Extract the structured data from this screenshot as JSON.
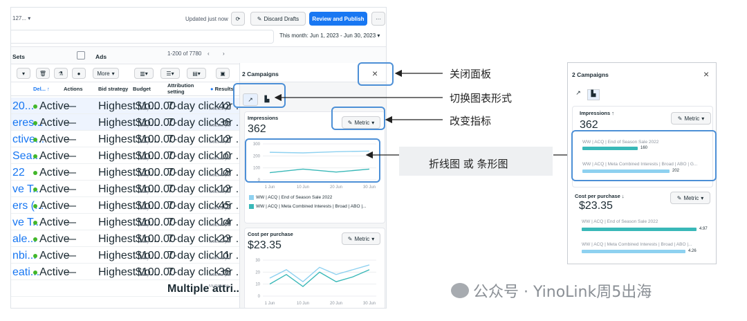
{
  "toolbar": {
    "account": "127...",
    "updated": "Updated just now",
    "discard": "Discard Drafts",
    "publish": "Review and Publish",
    "more": "···",
    "date_range": "This month: Jun 1, 2023 - Jun 30, 2023"
  },
  "tabs": {
    "sets": "Sets",
    "ads": "Ads",
    "pager": "1-200 of 7780"
  },
  "actions": {
    "more": "More"
  },
  "table": {
    "headers": [
      "Del... ↑",
      "Actions",
      "Bid strategy",
      "Budget",
      "Attribution setting",
      "Results"
    ],
    "rows": [
      {
        "name": "20...",
        "status": "Active",
        "actions": "—",
        "bid": "Highest vo...",
        "budget": "$100.00",
        "period": "Daily",
        "attr": "7-day click or ...",
        "result": "42",
        "rsub": "Website pur"
      },
      {
        "name": "eres...",
        "status": "Active",
        "actions": "—",
        "bid": "Highest vo...",
        "budget": "$100.00",
        "period": "Daily",
        "attr": "7-day click or ...",
        "result": "36",
        "rsub": "Website pur"
      },
      {
        "name": "ctive...",
        "status": "Active",
        "actions": "—",
        "bid": "Highest vo...",
        "budget": "$100.00",
        "period": "Daily",
        "attr": "7-day click or ...",
        "result": "12",
        "rsub": "Website pur"
      },
      {
        "name": "Sea...",
        "status": "Active",
        "actions": "—",
        "bid": "Highest vo...",
        "budget": "$100.00",
        "period": "Daily",
        "attr": "7-day click or ...",
        "result": "10",
        "rsub": "Website pur"
      },
      {
        "name": "22",
        "status": "Active",
        "actions": "—",
        "bid": "Highest vo...",
        "budget": "$100.00",
        "period": "Daily",
        "attr": "7-day click or ...",
        "result": "18",
        "rsub": "Website pur"
      },
      {
        "name": "ve T...",
        "status": "Active",
        "actions": "—",
        "bid": "Highest vo...",
        "budget": "$100.00",
        "period": "Daily",
        "attr": "7-day click or ...",
        "result": "12",
        "rsub": "Website pur"
      },
      {
        "name": "ers (...",
        "status": "Active",
        "actions": "—",
        "bid": "Highest vo...",
        "budget": "$100.00",
        "period": "Daily",
        "attr": "7-day click or ...",
        "result": "45",
        "rsub": "Website pur"
      },
      {
        "name": "ve T...",
        "status": "Active",
        "actions": "—",
        "bid": "Highest vo...",
        "budget": "$100.00",
        "period": "Daily",
        "attr": "7-day click or ...",
        "result": "14",
        "rsub": "Website pur"
      },
      {
        "name": "ale...",
        "status": "Active",
        "actions": "—",
        "bid": "Highest vo...",
        "budget": "$100.00",
        "period": "Daily",
        "attr": "7-day click or ...",
        "result": "23",
        "rsub": "Website pur"
      },
      {
        "name": "nbi...",
        "status": "Active",
        "actions": "—",
        "bid": "Highest vo...",
        "budget": "$100.00",
        "period": "Daily",
        "attr": "7-day click or ...",
        "result": "11",
        "rsub": "Website pur"
      },
      {
        "name": "eati...",
        "status": "Active",
        "actions": "—",
        "bid": "Highest vo...",
        "budget": "$100.00",
        "period": "Daily",
        "attr": "7-day click or ...",
        "result": "36",
        "rsub": "Website pur"
      }
    ],
    "footer": {
      "attr": "Multiple attri...",
      "result": "Multiple co"
    }
  },
  "panel": {
    "title": "2 Campaigns",
    "close": "×",
    "metric": "Metric",
    "impressions": {
      "label": "Impressions",
      "value": "362"
    },
    "cpp": {
      "label": "Cost per purchase",
      "value": "$23.35"
    },
    "legend": [
      "WW | ACQ | End of Season Sale 2022",
      "WW | ACQ | Meta Combined Interests | Broad | ABO |..."
    ],
    "imp_yticks": [
      "300",
      "200",
      "100",
      "0"
    ],
    "cpp_yticks": [
      "30",
      "20",
      "10",
      "0"
    ],
    "xticks": [
      "1 Jun",
      "10 Jun",
      "20 Jun",
      "30 Jun"
    ]
  },
  "annotations": [
    "关闭面板",
    "切换图表形式",
    "改变指标",
    "折线图 或 条形图"
  ],
  "right_panel": {
    "title": "2 Campaigns",
    "close": "×",
    "metric": "Metric",
    "impressions": {
      "label": "Impressions ↑",
      "value": "362",
      "bars": [
        {
          "name": "WW | ACQ | End of Season Sale 2022",
          "value": "160"
        },
        {
          "name": "WW | ACQ | Meta Combined Interests | Broad | ABO | G...",
          "value": "202"
        }
      ]
    },
    "cpp": {
      "label": "Cost per purchase ↓",
      "value": "$23.35",
      "bars": [
        {
          "name": "WW | ACQ | End of Season Sale 2022",
          "value": "4.97"
        },
        {
          "name": "WW | ACQ | Meta Combined Interests | Broad | ABO |...",
          "value": "4.26"
        }
      ]
    }
  },
  "watermark": "公众号 · YinoLink周5出海",
  "chart_data": {
    "type": "line",
    "x": [
      "1 Jun",
      "10 Jun",
      "20 Jun",
      "30 Jun"
    ],
    "series": [
      {
        "name": "WW | ACQ | End of Season Sale 2022",
        "values": [
          230,
          225,
          235,
          240
        ]
      },
      {
        "name": "WW | ACQ | Meta Combined Interests | Broad | ABO |...",
        "values": [
          60,
          90,
          65,
          90
        ]
      }
    ],
    "ylim": [
      0,
      300
    ]
  },
  "colors": {
    "accent": "#1877f2",
    "series1": "#8ed1f0",
    "series2": "#39b8b8",
    "callout": "#4c8fd6",
    "active": "#42b72a"
  }
}
